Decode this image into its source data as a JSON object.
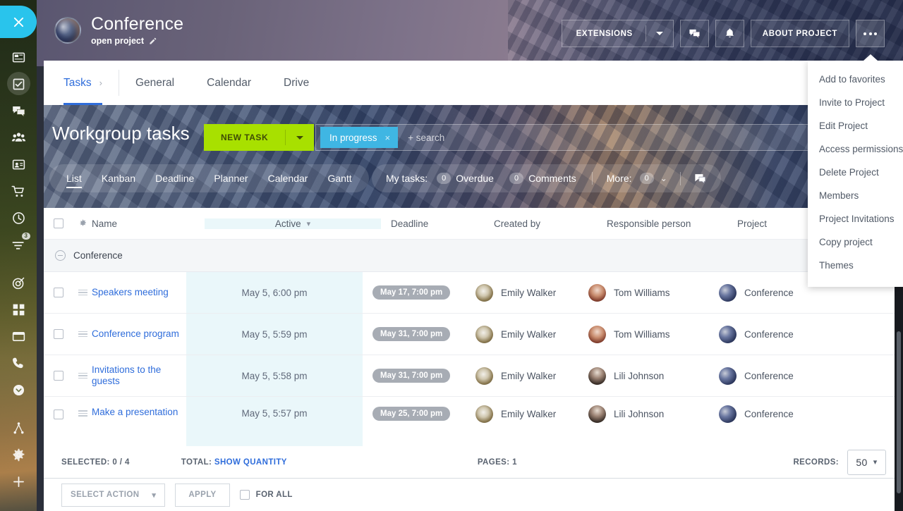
{
  "sidebar": {
    "close_label": "Close",
    "items": [
      {
        "name": "news-icon",
        "badge": ""
      },
      {
        "name": "tasks-icon",
        "badge": "",
        "active": true
      },
      {
        "name": "chat-icon",
        "badge": ""
      },
      {
        "name": "group-icon",
        "badge": ""
      },
      {
        "name": "contacts-icon",
        "badge": ""
      },
      {
        "name": "cart-icon",
        "badge": ""
      },
      {
        "name": "clock-icon",
        "badge": ""
      },
      {
        "name": "filter-icon",
        "badge": "3"
      },
      {
        "name": "crm-target-icon",
        "badge": ""
      },
      {
        "name": "apps-grid-icon",
        "badge": ""
      },
      {
        "name": "window-icon",
        "badge": ""
      },
      {
        "name": "phone-icon",
        "badge": ""
      },
      {
        "name": "chevron-down-circle-icon",
        "badge": ""
      },
      {
        "name": "sitemap-icon",
        "badge": ""
      },
      {
        "name": "settings-gear-icon",
        "badge": ""
      },
      {
        "name": "plus-icon",
        "badge": ""
      }
    ]
  },
  "header": {
    "project_title": "Conference",
    "project_subtitle": "open project",
    "extensions_label": "EXTENSIONS",
    "about_project_label": "ABOUT PROJECT",
    "chat_icon": "chat-icon",
    "bell_icon": "notifications-bell-icon",
    "more_icon": "more-dots-icon"
  },
  "tabs": [
    {
      "label": "Tasks",
      "active": true
    },
    {
      "label": "General",
      "active": false
    },
    {
      "label": "Calendar",
      "active": false
    },
    {
      "label": "Drive",
      "active": false
    }
  ],
  "banner": {
    "title": "Workgroup tasks",
    "new_task_label": "NEW TASK",
    "search": {
      "chip": "In progress",
      "chip_close": "×",
      "placeholder": "+ search"
    },
    "view_modes": [
      {
        "label": "List",
        "active": true
      },
      {
        "label": "Kanban",
        "active": false
      },
      {
        "label": "Deadline",
        "active": false
      },
      {
        "label": "Planner",
        "active": false
      },
      {
        "label": "Calendar",
        "active": false
      },
      {
        "label": "Gantt",
        "active": false
      }
    ],
    "my_tasks": {
      "label": "My tasks:",
      "overdue_count": "0",
      "overdue_label": "Overdue",
      "comments_count": "0",
      "comments_label": "Comments",
      "more_label": "More:",
      "more_count": "0"
    }
  },
  "table": {
    "columns": {
      "name": "Name",
      "active": "Active",
      "deadline": "Deadline",
      "created_by": "Created by",
      "responsible": "Responsible person",
      "project": "Project"
    },
    "group_label": "Conference",
    "rows": [
      {
        "name": "Speakers meeting",
        "active": "May 5, 6:00 pm",
        "deadline": "May 17, 7:00 pm",
        "created_by": "Emily Walker",
        "responsible": "Tom Williams",
        "project": "Conference",
        "created_av": "emily",
        "resp_av": "tom"
      },
      {
        "name": "Conference program",
        "active": "May 5, 5:59 pm",
        "deadline": "May 31, 7:00 pm",
        "created_by": "Emily Walker",
        "responsible": "Tom Williams",
        "project": "Conference",
        "created_av": "emily",
        "resp_av": "tom"
      },
      {
        "name": "Invitations to the guests",
        "active": "May 5, 5:58 pm",
        "deadline": "May 31, 7:00 pm",
        "created_by": "Emily Walker",
        "responsible": "Lili Johnson",
        "project": "Conference",
        "created_av": "emily",
        "resp_av": "lili"
      },
      {
        "name": "Make a presentation",
        "active": "May 5, 5:57 pm",
        "deadline": "May 25, 7:00 pm",
        "created_by": "Emily Walker",
        "responsible": "Lili Johnson",
        "project": "Conference",
        "created_av": "emily",
        "resp_av": "lili"
      }
    ]
  },
  "footer": {
    "selected_label": "SELECTED:",
    "selected_value": "0 / 4",
    "total_label": "TOTAL:",
    "total_link": "SHOW QUANTITY",
    "pages_label": "PAGES:",
    "pages_value": "1",
    "records_label": "RECORDS:",
    "records_value": "50",
    "select_action_label": "SELECT ACTION",
    "apply_label": "APPLY",
    "for_all_label": "FOR ALL"
  },
  "menu": {
    "items": [
      "Add to favorites",
      "Invite to Project",
      "Edit Project",
      "Access permissions",
      "Delete Project",
      "Members",
      "Project Invitations",
      "Copy project",
      "Themes"
    ]
  },
  "colors": {
    "accent_blue": "#2f6ddb",
    "chip_blue": "#3fb6e3",
    "new_task_green": "#a8e000",
    "cyan_close": "#29c4ec"
  }
}
